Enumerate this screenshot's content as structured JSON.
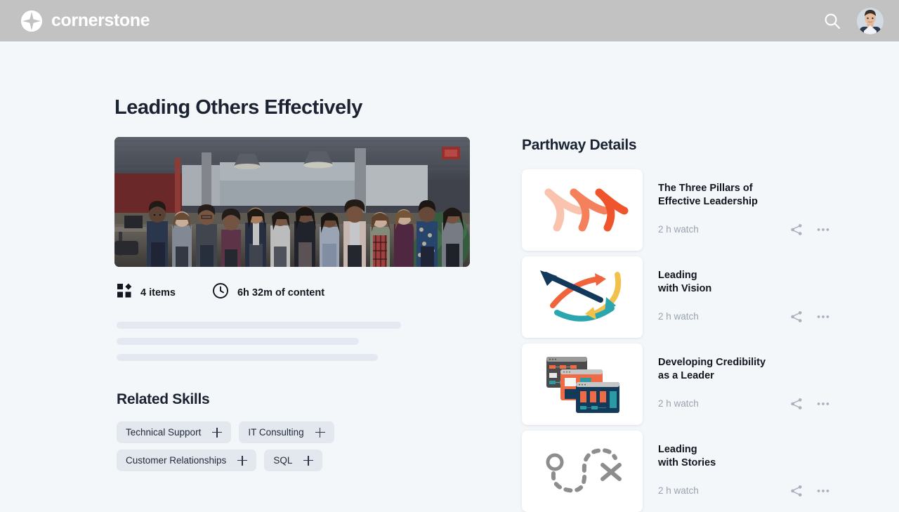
{
  "header": {
    "brand_name": "cornerstone",
    "brand_icon": "sparkle-logo-icon",
    "search_icon": "search-icon",
    "avatar_icon": "user-avatar",
    "bar_color": "#c2c2c2"
  },
  "page": {
    "title": "Leading Others Effectively",
    "background_color": "#f4f7fa",
    "text_color": "#1b2333"
  },
  "hero": {
    "alt": "group of women standing together in an office",
    "image_name": "pathway-hero-image"
  },
  "meta": [
    {
      "icon": "blocks-grid-icon",
      "label": "4 items"
    },
    {
      "icon": "clock-icon",
      "label": "6h 32m of content"
    }
  ],
  "description_skeleton": {
    "bar_color": "#e4e9f1",
    "bar_widths": [
      "405px",
      "345px",
      "372px"
    ]
  },
  "skills": {
    "title": "Related Skills",
    "chip_background": "#e3e8ef",
    "add_icon": "plus-icon",
    "rows": [
      [
        {
          "label": "Technical Support"
        },
        {
          "label": "IT Consulting"
        }
      ],
      [
        {
          "label": "Customer Relationships"
        },
        {
          "label": "SQL"
        }
      ]
    ]
  },
  "details": {
    "title": "Parthway Details",
    "share_icon": "share-icon",
    "more_icon": "more-options-icon",
    "duration_color": "#9aa3b0",
    "courses": [
      {
        "title": "The Three Pillars of\nEffective Leadership",
        "duration": "2 h watch",
        "thumbnail": "triple-chevron-arrows-icon",
        "thumbnail_colors": [
          "#f9c3ad",
          "#f4805c",
          "#f0542d"
        ]
      },
      {
        "title": "Leading\nwith Vision",
        "duration": "2 h watch",
        "thumbnail": "crossing-curved-arrows-icon",
        "thumbnail_colors": [
          "#12395c",
          "#f0643c",
          "#f2c14b",
          "#2aa7ae"
        ]
      },
      {
        "title": "Developing Credibility\nas a Leader",
        "duration": "2 h watch",
        "thumbnail": "stacked-dashboard-windows-icon",
        "thumbnail_colors": [
          "#4a4a4a",
          "#ef6b45",
          "#143a5a",
          "#2a9aa5"
        ]
      },
      {
        "title": "Leading\nwith Stories",
        "duration": "2 h watch",
        "thumbnail": "dashed-map-route-icon",
        "thumbnail_colors": [
          "#8d8d8d"
        ]
      }
    ]
  }
}
